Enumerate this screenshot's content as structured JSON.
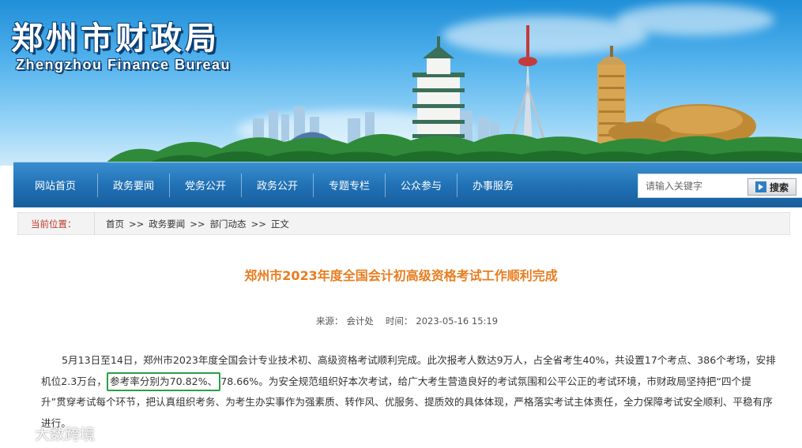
{
  "header": {
    "site_name_cn": "郑州市财政局",
    "site_name_en": "Zhengzhou Finance Bureau"
  },
  "nav": {
    "items": [
      {
        "label": "网站首页"
      },
      {
        "label": "政务要闻"
      },
      {
        "label": "党务公开"
      },
      {
        "label": "政务公开"
      },
      {
        "label": "专题专栏"
      },
      {
        "label": "公众参与"
      },
      {
        "label": "办事服务"
      }
    ],
    "search": {
      "placeholder": "请输入关键字",
      "button_label": "搜索"
    }
  },
  "breadcrumb": {
    "label": "当前位置：",
    "items": [
      "首页",
      "政务要闻",
      "部门动态",
      "正文"
    ],
    "separator": ">>"
  },
  "article": {
    "title": "郑州市2023年度全国会计初高级资格考试工作顺利完成",
    "source_label": "来源：",
    "source": "会计处",
    "time_label": "时间：",
    "time": "2023-05-16 15:19",
    "body_before": "5月13日至14日，郑州市2023年度全国会计专业技术初、高级资格考试顺利完成。此次报考人数达9万人，占全省考生40%，共设置17个考点、386个考场，安排机位2.3万台，",
    "body_highlight": "参考率分别为70.82%、",
    "body_after": "78.66%。为安全规范组织好本次考试，给广大考生营造良好的考试氛围和公平公正的考试环境，市财政局坚持把“四个提升”贯穿考试每个环节，把认真组织考务、为考生办实事作为强素质、转作风、优服务、提质效的具体体现，严格落实考试主体责任，全力保障考试安全顺利、平稳有序进行。"
  },
  "watermark": {
    "text": "大数跨境"
  },
  "colors": {
    "nav_bg": "#1f6fb3",
    "title": "#e77d20",
    "breadcrumb_label": "#c0392b",
    "highlight_border": "#27a048"
  }
}
